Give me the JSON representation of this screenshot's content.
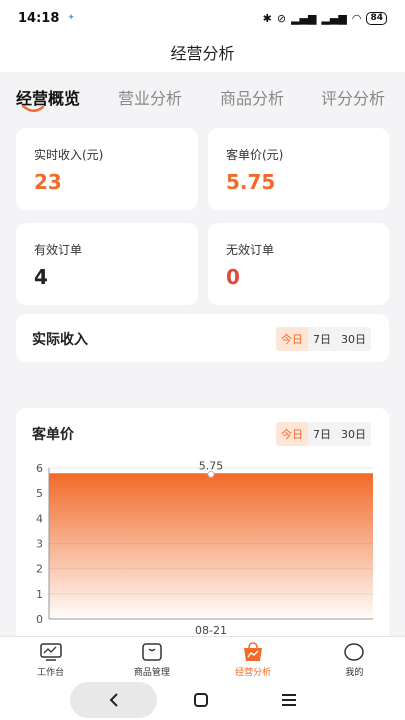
{
  "status_bar": {
    "time": "14:18",
    "battery": "84"
  },
  "header": {
    "title": "经营分析"
  },
  "tabs": [
    {
      "label": "经营概览",
      "active": true
    },
    {
      "label": "营业分析",
      "active": false
    },
    {
      "label": "商品分析",
      "active": false
    },
    {
      "label": "评分分析",
      "active": false
    }
  ],
  "metrics": {
    "realtime_income": {
      "label": "实时收入(元)",
      "value": "23"
    },
    "avg_order_price": {
      "label": "客单价(元)",
      "value": "5.75"
    },
    "valid_orders": {
      "label": "有效订单",
      "value": "4"
    },
    "invalid_orders": {
      "label": "无效订单",
      "value": "0"
    }
  },
  "actual_income": {
    "title": "实际收入",
    "ranges": [
      "今日",
      "7日",
      "30日"
    ],
    "selected": "今日"
  },
  "price_section": {
    "title": "客单价",
    "ranges": [
      "今日",
      "7日",
      "30日"
    ],
    "selected": "今日"
  },
  "chart_data": {
    "type": "area",
    "categories": [
      "08-21"
    ],
    "values": [
      5.75
    ],
    "data_labels": [
      "5.75"
    ],
    "yticks": [
      "0",
      "1",
      "2",
      "3",
      "4",
      "5",
      "6"
    ],
    "ylim": [
      0,
      6
    ],
    "grid": true,
    "color": "#f26b2a"
  },
  "bottom_nav": [
    {
      "label": "工作台",
      "icon": "monitor-icon",
      "active": false
    },
    {
      "label": "商品管理",
      "icon": "box-icon",
      "active": false
    },
    {
      "label": "经营分析",
      "icon": "chart-bag-icon",
      "active": true
    },
    {
      "label": "我的",
      "icon": "person-icon",
      "active": false
    }
  ],
  "colors": {
    "accent": "#f26b2a",
    "invalid": "#e04a3c"
  }
}
